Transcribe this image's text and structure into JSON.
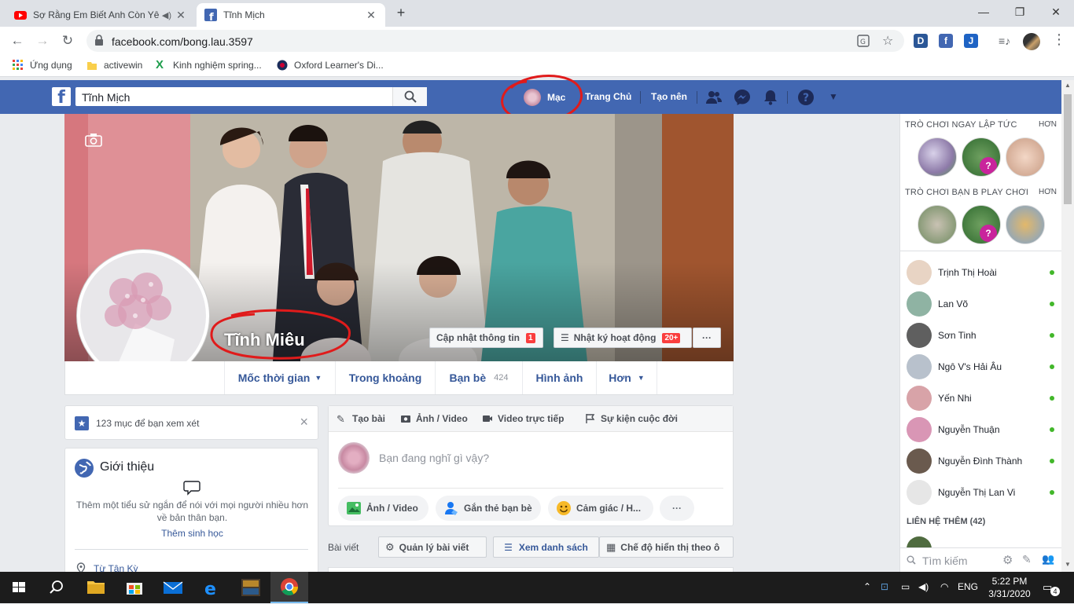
{
  "browser": {
    "tabs": [
      {
        "title": "Sợ Rằng Em Biết Anh Còn Yêu",
        "icon": "youtube-icon"
      },
      {
        "title": "Tĩnh Mịch",
        "icon": "facebook-icon"
      }
    ],
    "url": "facebook.com/bong.lau.3597",
    "bookmarks": [
      {
        "label": "Ứng dụng",
        "icon": "apps-grid-icon"
      },
      {
        "label": "activewin",
        "icon": "folder-icon"
      },
      {
        "label": "Kinh nghiệm spring...",
        "icon": "x-logo-icon"
      },
      {
        "label": "Oxford Learner's Di...",
        "icon": "oxford-icon"
      }
    ]
  },
  "fb_header": {
    "search_value": "Tĩnh Mịch",
    "user_name": "Mạc",
    "home": "Trang Chủ",
    "create": "Tạo nên"
  },
  "profile": {
    "name": "Tĩnh Miêu",
    "update_info": "Cập nhật thông tin",
    "update_badge": "1",
    "activity_log": "Nhật ký hoạt động",
    "activity_badge": "20+",
    "more": "···",
    "nav": [
      {
        "label": "Mốc thời gian",
        "caret": "▼",
        "count": ""
      },
      {
        "label": "Trong khoảng",
        "caret": "",
        "count": ""
      },
      {
        "label": "Bạn bè",
        "caret": "",
        "count": "424"
      },
      {
        "label": "Hình ảnh",
        "caret": "",
        "count": ""
      },
      {
        "label": "Hơn",
        "caret": "▼",
        "count": ""
      }
    ]
  },
  "left": {
    "review_text": "123 mục để bạn xem xét",
    "close": "×",
    "intro_title": "Giới thiệu",
    "intro_desc": "Thêm một tiểu sử ngắn để nói với mọi người nhiều hơn về bản thân bạn.",
    "intro_link": "Thêm sinh học",
    "hometown": "Từ Tân Kỳ"
  },
  "composer": {
    "tabs": [
      "Tạo bài",
      "Ảnh / Video",
      "Video trực tiếp",
      "Sự kiện cuộc đời"
    ],
    "placeholder": "Bạn đang nghĩ gì vậy?",
    "pills": [
      "Ảnh / Video",
      "Gắn thẻ bạn bè",
      "Cảm giác / H...",
      "···"
    ]
  },
  "posts_bar": {
    "label": "Bài viết",
    "manage": "Quản lý bài viết",
    "list_view": "Xem danh sách",
    "grid_view": "Chế độ hiển thị theo ô"
  },
  "right": {
    "games_header": "TRÒ CHƠI NGAY LẬP TỨC",
    "games_more": "HƠN",
    "friends_games_header": "TRÒ CHƠI BẠN B PLAY CHƠI",
    "friends_games_more": "HƠN",
    "friends": [
      "Trịnh Thị Hoài",
      "Lan Võ",
      "Sơn Tinh",
      "Ngô V's Hải Âu",
      "Yến Nhi",
      "Nguyễn Thuận",
      "Nguyễn Đình Thành",
      "Nguyễn Thị Lan Vi"
    ],
    "contacts_header": "LIÊN HỆ THÊM (42)",
    "search_placeholder": "Tìm kiếm"
  },
  "taskbar": {
    "time": "5:22 PM",
    "date": "3/31/2020",
    "lang": "ENG",
    "notif_count": "4"
  },
  "colors": {
    "fb_blue": "#4267b2",
    "link": "#365899",
    "online": "#42b72a",
    "annotation_red": "#e01b1b"
  }
}
